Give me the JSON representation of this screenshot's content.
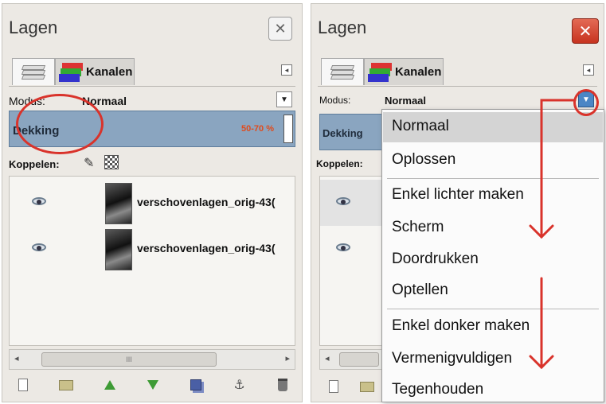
{
  "left_panel": {
    "title": "Lagen",
    "close_glyph": "✕",
    "tab_channels_label": "Kanalen",
    "mode_label": "Modus:",
    "mode_value": "Normaal",
    "opacity_label": "Dekking",
    "opacity_value": "50-70 %",
    "link_label": "Koppelen:",
    "layers": [
      {
        "name": "verschovenlagen_orig-43("
      },
      {
        "name": "verschovenlagen_orig-43("
      }
    ],
    "scroll_thumb_text": "III"
  },
  "right_panel": {
    "title": "Lagen",
    "close_glyph": "✕",
    "tab_channels_label": "Kanalen",
    "mode_label": "Modus:",
    "mode_value": "Normaal",
    "opacity_label": "Dekking",
    "link_label": "Koppelen:"
  },
  "mode_menu": {
    "items": [
      "Normaal",
      "Oplossen",
      "Enkel lichter maken",
      "Scherm",
      "Doordrukken",
      "Optellen",
      "Enkel donker maken",
      "Vermenigvuldigen",
      "Tegenhouden"
    ],
    "selected": "Normaal"
  },
  "annotation_color": "#d9332b",
  "icons": {
    "visibility": "eye-icon",
    "link": "chain-icon",
    "new_layer": "new-layer-icon",
    "new_group": "folder-icon",
    "raise": "arrow-up-icon",
    "lower": "arrow-down-icon",
    "duplicate": "duplicate-icon",
    "anchor": "anchor-icon",
    "delete": "trash-icon"
  }
}
